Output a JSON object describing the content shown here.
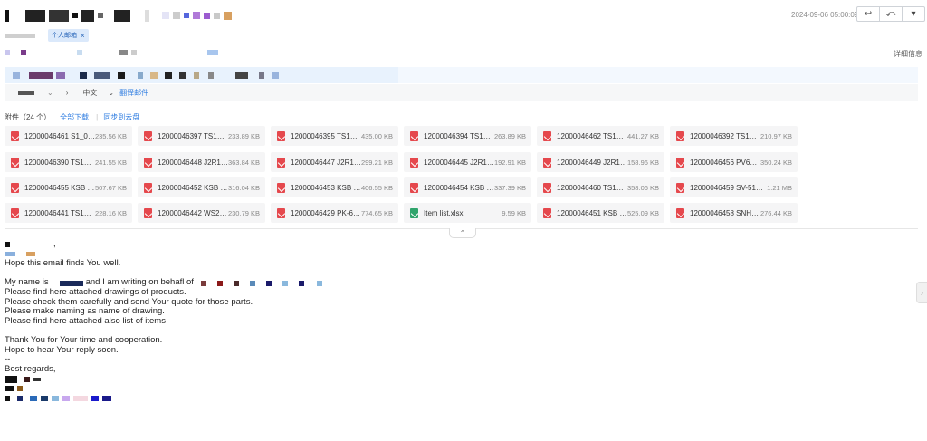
{
  "header": {
    "date": "2024-09-06 05:00:09",
    "actions": [
      {
        "name": "reply-icon",
        "glyph": "↩"
      },
      {
        "name": "reply-all-icon",
        "glyph": "⤺"
      },
      {
        "name": "more-dropdown-icon",
        "glyph": "▾"
      }
    ]
  },
  "tags": {
    "tag_label": "个人邮箱",
    "tag_close": "×"
  },
  "details_link": "详细信息",
  "translate": {
    "arrow": "›",
    "language": "中文",
    "chevron": "⌄",
    "translate_link": "翻译邮件"
  },
  "attachments": {
    "count_label": "附件（24 个）",
    "download_all": "全部下载",
    "separator": "|",
    "save_to_cloud": "同步到云盘",
    "items": [
      {
        "name": "12000046461 S1_014-...",
        "size": "235.56 KB",
        "type": "pdf"
      },
      {
        "name": "12000046397 TS1_014...",
        "size": "233.89 KB",
        "type": "pdf"
      },
      {
        "name": "12000046395 TS1_014...",
        "size": "435.00 KB",
        "type": "pdf"
      },
      {
        "name": "12000046394 TS1_014...",
        "size": "263.89 KB",
        "type": "pdf"
      },
      {
        "name": "12000046462 TS1_014...",
        "size": "441.27 KB",
        "type": "pdf"
      },
      {
        "name": "12000046392 TS1_014...",
        "size": "210.97 KB",
        "type": "pdf"
      },
      {
        "name": "12000046390 TS1_014...",
        "size": "241.55 KB",
        "type": "pdf"
      },
      {
        "name": "12000046448 J2R160-...",
        "size": "363.84 KB",
        "type": "pdf"
      },
      {
        "name": "12000046447 J2R160-...",
        "size": "299.21 KB",
        "type": "pdf"
      },
      {
        "name": "12000046445 J2R160-...",
        "size": "192.91 KB",
        "type": "pdf"
      },
      {
        "name": "12000046449 J2R160-...",
        "size": "158.96 KB",
        "type": "pdf"
      },
      {
        "name": "12000046456 PV60.01 ...",
        "size": "350.24 KB",
        "type": "pdf"
      },
      {
        "name": "12000046455 KSB CPK...",
        "size": "507.67 KB",
        "type": "pdf"
      },
      {
        "name": "12000046452 KSB CPK...",
        "size": "316.04 KB",
        "type": "pdf"
      },
      {
        "name": "12000046453 KSB CPK...",
        "size": "406.55 KB",
        "type": "pdf"
      },
      {
        "name": "12000046454 KSB CPK...",
        "size": "337.39 KB",
        "type": "pdf"
      },
      {
        "name": "12000046460 TS1_014...",
        "size": "358.06 KB",
        "type": "pdf"
      },
      {
        "name": "12000046459 SV-51-2...",
        "size": "1.21 MB",
        "type": "pdf"
      },
      {
        "name": "12000046441 TS1_014...",
        "size": "228.16 KB",
        "type": "pdf"
      },
      {
        "name": "12000046442 WS2_14...",
        "size": "230.79 KB",
        "type": "pdf"
      },
      {
        "name": "12000046429 PK-603...",
        "size": "774.65 KB",
        "type": "pdf"
      },
      {
        "name": "Item list.xlsx",
        "size": "9.59 KB",
        "type": "xlsx"
      },
      {
        "name": "12000046451 KSB CPK...",
        "size": "525.09 KB",
        "type": "pdf"
      },
      {
        "name": "12000046458 SNH70.0...",
        "size": "276.44 KB",
        "type": "pdf"
      }
    ]
  },
  "collapse_glyph": "⌃",
  "side_glyph": "›",
  "body": {
    "greeting_tail": ",",
    "line_hope": "Hope this email finds You well.",
    "line_name_a": "My name is",
    "line_name_b": "and I am writing on behafl of",
    "line_1": "Please find here attached drawings of products.",
    "line_2": "Please check them carefully and send Your quote for those parts.",
    "line_3": "Please make naming as name of drawing.",
    "line_4": "Please find here attached also list of items",
    "line_thanks": "Thank You for Your time and cooperation.",
    "line_hope2": "Hope to hear Your reply soon.",
    "line_dash": "--",
    "line_regards": "Best regards,"
  }
}
